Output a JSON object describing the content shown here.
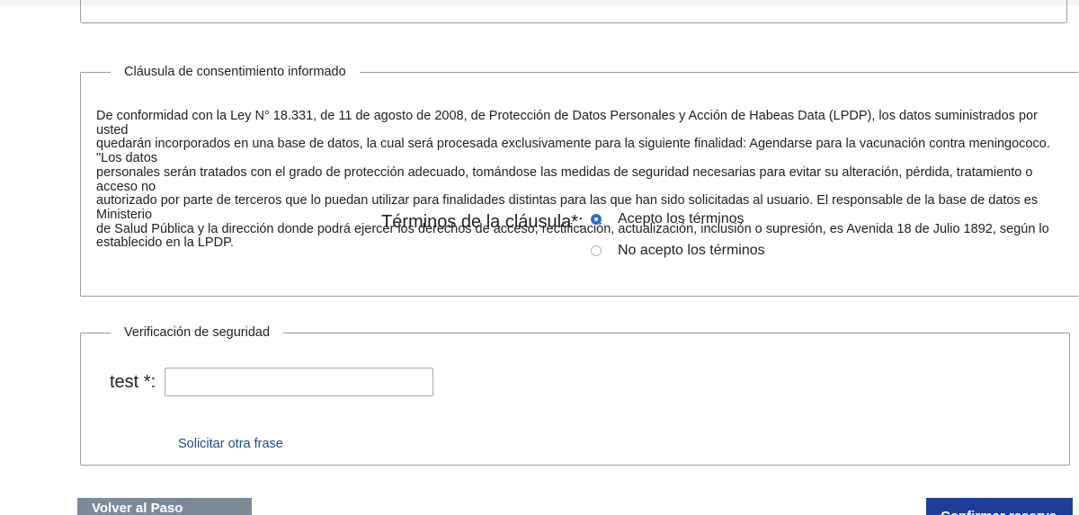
{
  "consent": {
    "legend": "Cláusula de consentimiento informado",
    "text_lines": [
      "De conformidad con la Ley N° 18.331, de 11 de agosto de 2008, de Protección de Datos Personales y Acción de Habeas Data (LPDP), los datos suministrados por usted",
      "quedarán incorporados en una base de datos, la cual será procesada exclusivamente para la siguiente finalidad: Agendarse para la vacunación contra meningococo. \"Los datos",
      "personales serán tratados con el grado de protección adecuado, tomándose las medidas de seguridad necesarias para evitar su alteración, pérdida, tratamiento o acceso no",
      "autorizado por parte de terceros que lo puedan utilizar para finalidades distintas para las que han sido solicitadas al usuario. El responsable de la base de datos es Ministerio",
      "de Salud Pública y la dirección donde podrá ejercer los derechos de acceso, rectificación, actualización, inclusión o supresión, es Avenida 18 de Julio 1892, según lo",
      "establecido en la LPDP."
    ],
    "terms_label": "Términos de la cláusula*:",
    "options": [
      {
        "label": "Acepto los términos",
        "selected": true
      },
      {
        "label": "No acepto los términos",
        "selected": false
      }
    ]
  },
  "security": {
    "legend": "Verificación de seguridad",
    "test_label": "test *:",
    "test_value": "",
    "new_phrase_link": "Solicitar otra frase"
  },
  "buttons": {
    "back_label": "Volver al Paso Anterior",
    "confirm_label": "Confirmar reserva"
  },
  "colors": {
    "back_button": "#7d8a98",
    "confirm_button": "#1d3f99",
    "link": "#1c4c8f",
    "radio_selected": "#2a6fd6"
  }
}
